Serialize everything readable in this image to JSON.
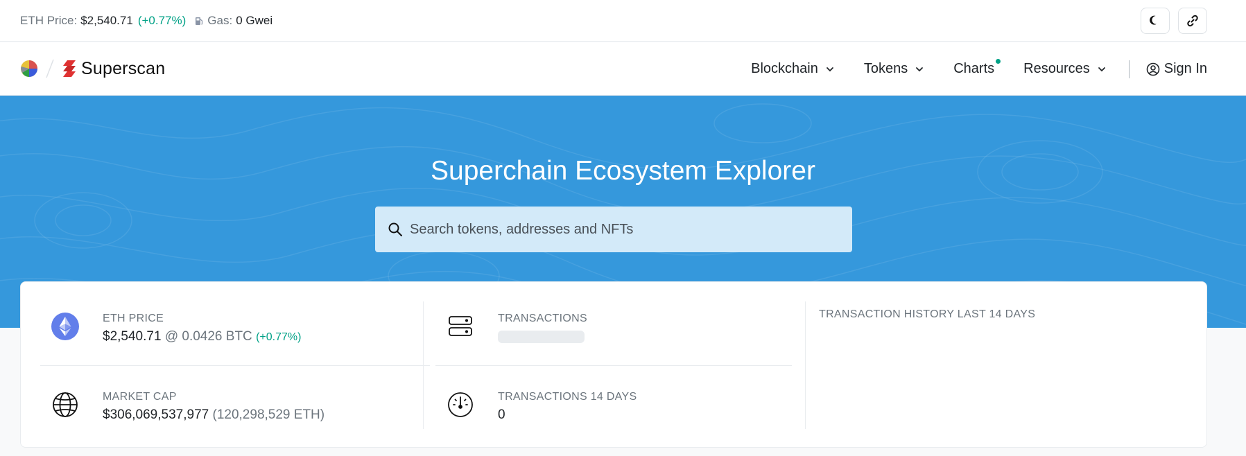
{
  "topbar": {
    "eth_price_label": "ETH Price:",
    "eth_price_value": "$2,540.71",
    "eth_price_change": "(+0.77%)",
    "gas_label": "Gas:",
    "gas_value": "0 Gwei"
  },
  "header": {
    "brand_name": "Superscan",
    "nav": [
      {
        "label": "Blockchain"
      },
      {
        "label": "Tokens"
      },
      {
        "label": "Charts"
      },
      {
        "label": "Resources"
      }
    ],
    "sign_in_label": "Sign In"
  },
  "hero": {
    "title": "Superchain Ecosystem Explorer",
    "search_placeholder": "Search tokens, addresses and NFTs"
  },
  "stats": {
    "eth_price": {
      "label": "ETH PRICE",
      "value": "$2,540.71",
      "btc": "@ 0.0426 BTC",
      "change": "(+0.77%)"
    },
    "market_cap": {
      "label": "MARKET CAP",
      "value": "$306,069,537,977",
      "eth": "(120,298,529 ETH)"
    },
    "transactions": {
      "label": "TRANSACTIONS"
    },
    "transactions_14d": {
      "label": "TRANSACTIONS 14 DAYS",
      "value": "0"
    },
    "history": {
      "label": "TRANSACTION HISTORY LAST 14 DAYS"
    }
  },
  "colors": {
    "hero_bg": "#3598dc",
    "positive": "#00a186",
    "search_bg": "#d3eaf9"
  }
}
